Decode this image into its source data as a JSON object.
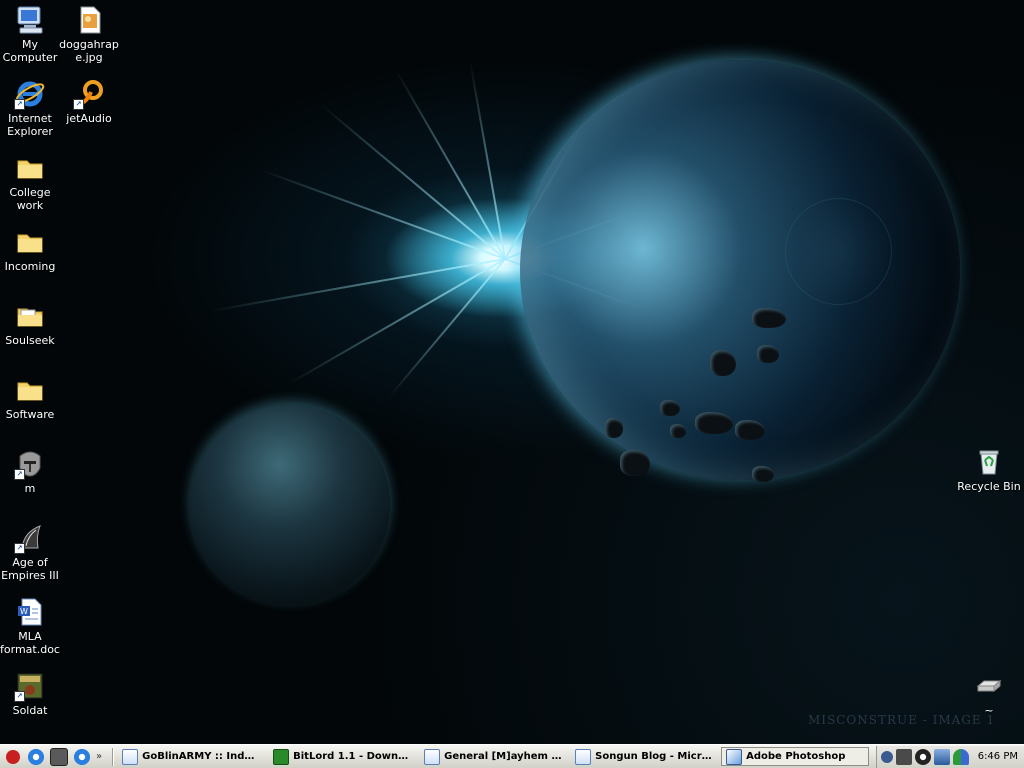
{
  "desktop": {
    "icons_left": [
      {
        "label": "My\nComputer",
        "icon": "my-computer-icon"
      },
      {
        "label": "Internet\nExplorer",
        "icon": "internet-explorer-icon"
      },
      {
        "label": "College\nwork",
        "icon": "folder-icon"
      },
      {
        "label": "Incoming",
        "icon": "folder-icon"
      },
      {
        "label": "Soulseek",
        "icon": "folder-icon"
      },
      {
        "label": "Software",
        "icon": "folder-icon"
      },
      {
        "label": "m",
        "icon": "helmet-shortcut-icon"
      },
      {
        "label": "Age of\nEmpires III",
        "icon": "age-of-empires-icon"
      },
      {
        "label": "MLA\nformat.doc",
        "icon": "word-document-icon"
      },
      {
        "label": "Soldat",
        "icon": "soldat-icon"
      }
    ],
    "icons_second": [
      {
        "label": "doggahrap\ne.jpg",
        "icon": "jpg-image-icon"
      },
      {
        "label": "jetAudio",
        "icon": "jetaudio-icon"
      }
    ],
    "icons_right": [
      {
        "label": "Recycle Bin",
        "icon": "recycle-bin-icon"
      },
      {
        "label": "~",
        "icon": "drive-icon"
      }
    ],
    "wallpaper_watermark": "MISCONSTRUE - IMAGE 1"
  },
  "taskbar": {
    "quick_launch": [
      "stop-icon",
      "internet-explorer-icon",
      "helmet-icon",
      "internet-explorer-icon"
    ],
    "chevron": "»",
    "tasks": [
      {
        "label": "GoBlinARMY :: Inde...",
        "icon": "ie-page-icon",
        "active": false
      },
      {
        "label": "BitLord 1.1 - Downl...",
        "icon": "bitlord-icon",
        "active": false
      },
      {
        "label": "General [M]ayhem -...",
        "icon": "ie-page-icon",
        "active": false
      },
      {
        "label": "Songun Blog - Micro...",
        "icon": "ie-page-icon",
        "active": false
      },
      {
        "label": "Adobe Photoshop",
        "icon": "photoshop-icon",
        "active": true
      }
    ],
    "tray_icons": [
      "expand-arrow-icon",
      "helmet-icon",
      "steam-icon",
      "network-icon",
      "users-icon"
    ],
    "clock": "6:46 PM"
  },
  "colors": {
    "taskbar_bg": "#e4e3dc",
    "desktop_bg": "#020608",
    "glow": "#5fd2f0"
  }
}
